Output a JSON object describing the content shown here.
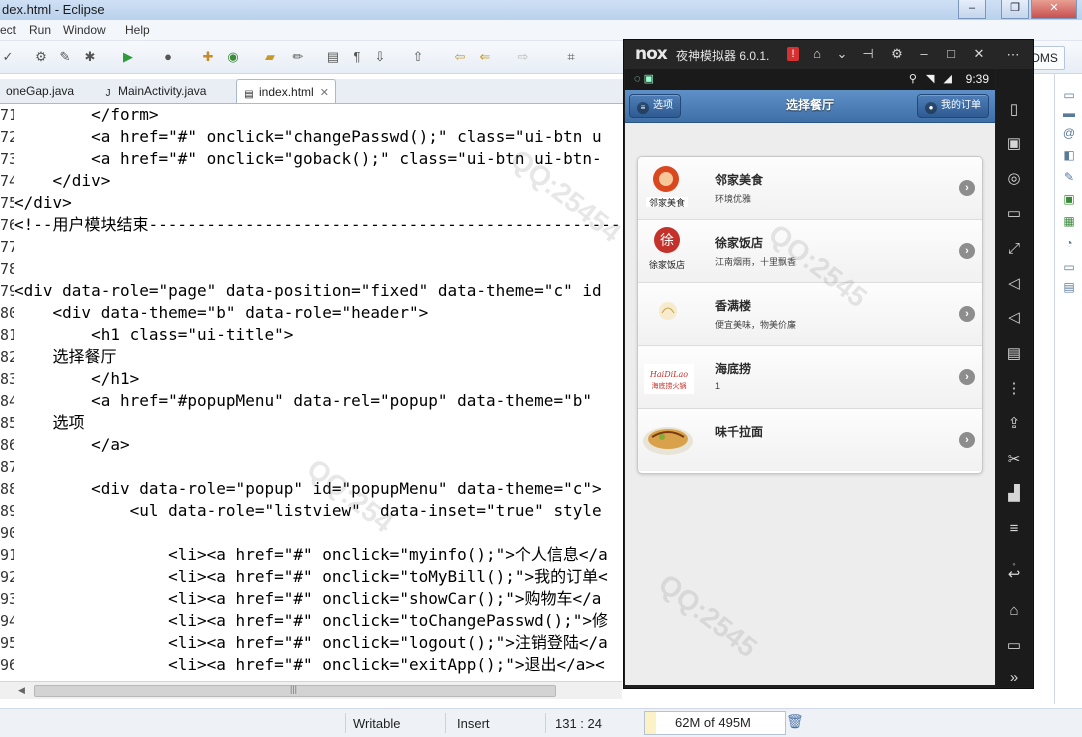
{
  "window": {
    "title": "dex.html - Eclipse",
    "controls": [
      "–",
      "❐",
      "✕"
    ]
  },
  "menu": [
    "ect",
    "Run",
    "Window",
    "Help"
  ],
  "toolbar": {
    "ddms_label": "DDMS"
  },
  "tabs": [
    {
      "label": "oneGap.java",
      "icon": "java-file-icon"
    },
    {
      "label": "MainActivity.java",
      "icon": "java-file-icon"
    },
    {
      "label": "index.html",
      "icon": "html-file-icon",
      "active": true
    }
  ],
  "code_lines": [
    {
      "num": "71",
      "text": "        </form>"
    },
    {
      "num": "72",
      "text": "        <a href=\"#\" onclick=\"changePasswd();\" class=\"ui-btn u"
    },
    {
      "num": "73",
      "text": "        <a href=\"#\" onclick=\"goback();\" class=\"ui-btn ui-btn-"
    },
    {
      "num": "74",
      "text": "    </div>"
    },
    {
      "num": "75",
      "text": "</div>"
    },
    {
      "num": "76",
      "text": "<!--用户模块结束-------------------------------------------------"
    },
    {
      "num": "77",
      "text": ""
    },
    {
      "num": "78",
      "text": ""
    },
    {
      "num": "79",
      "text": "<div data-role=\"page\" data-position=\"fixed\" data-theme=\"c\" id"
    },
    {
      "num": "80",
      "text": "    <div data-theme=\"b\" data-role=\"header\">"
    },
    {
      "num": "81",
      "text": "        <h1 class=\"ui-title\">"
    },
    {
      "num": "82",
      "text": "    选择餐厅"
    },
    {
      "num": "83",
      "text": "        </h1>"
    },
    {
      "num": "84",
      "text": "        <a href=\"#popupMenu\" data-rel=\"popup\" data-theme=\"b\""
    },
    {
      "num": "85",
      "text": "    选项"
    },
    {
      "num": "86",
      "text": "        </a>"
    },
    {
      "num": "87",
      "text": ""
    },
    {
      "num": "88",
      "text": "        <div data-role=\"popup\" id=\"popupMenu\" data-theme=\"c\">"
    },
    {
      "num": "89",
      "text": "            <ul data-role=\"listview\"  data-inset=\"true\" style"
    },
    {
      "num": "90",
      "text": ""
    },
    {
      "num": "91",
      "text": "                <li><a href=\"#\" onclick=\"myinfo();\">个人信息</a"
    },
    {
      "num": "92",
      "text": "                <li><a href=\"#\" onclick=\"toMyBill();\">我的订单<"
    },
    {
      "num": "93",
      "text": "                <li><a href=\"#\" onclick=\"showCar();\">购物车</a"
    },
    {
      "num": "94",
      "text": "                <li><a href=\"#\" onclick=\"toChangePasswd();\">修"
    },
    {
      "num": "95",
      "text": "                <li><a href=\"#\" onclick=\"logout();\">注销登陆</a"
    },
    {
      "num": "96",
      "text": "                <li><a href=\"#\" onclick=\"exitApp();\">退出</a><"
    }
  ],
  "status_bar": {
    "mode": "Writable",
    "insert": "Insert",
    "position": "131 : 24",
    "heap": "62M of 495M"
  },
  "nox": {
    "logo": "nox",
    "title": "夜神模拟器 6.0.1.",
    "alert_mark": "!",
    "android_status": {
      "time": "9:39"
    },
    "app": {
      "header_title": "选择餐厅",
      "left_button": "选项",
      "right_button": "我的订单",
      "restaurants": [
        {
          "name": "邻家美食",
          "desc": "环境优雅"
        },
        {
          "name": "徐家饭店",
          "desc": "江南烟雨，十里飘香"
        },
        {
          "name": "香满楼",
          "desc": "便宜美味，物美价廉"
        },
        {
          "name": "海底捞",
          "desc": "1"
        },
        {
          "name": "味千拉面",
          "desc": ""
        }
      ]
    }
  },
  "colors": {
    "jqm_header": "#4a7db5",
    "nox_bg": "#1f1f1f",
    "eclipse_title": "#c4d8ef"
  }
}
